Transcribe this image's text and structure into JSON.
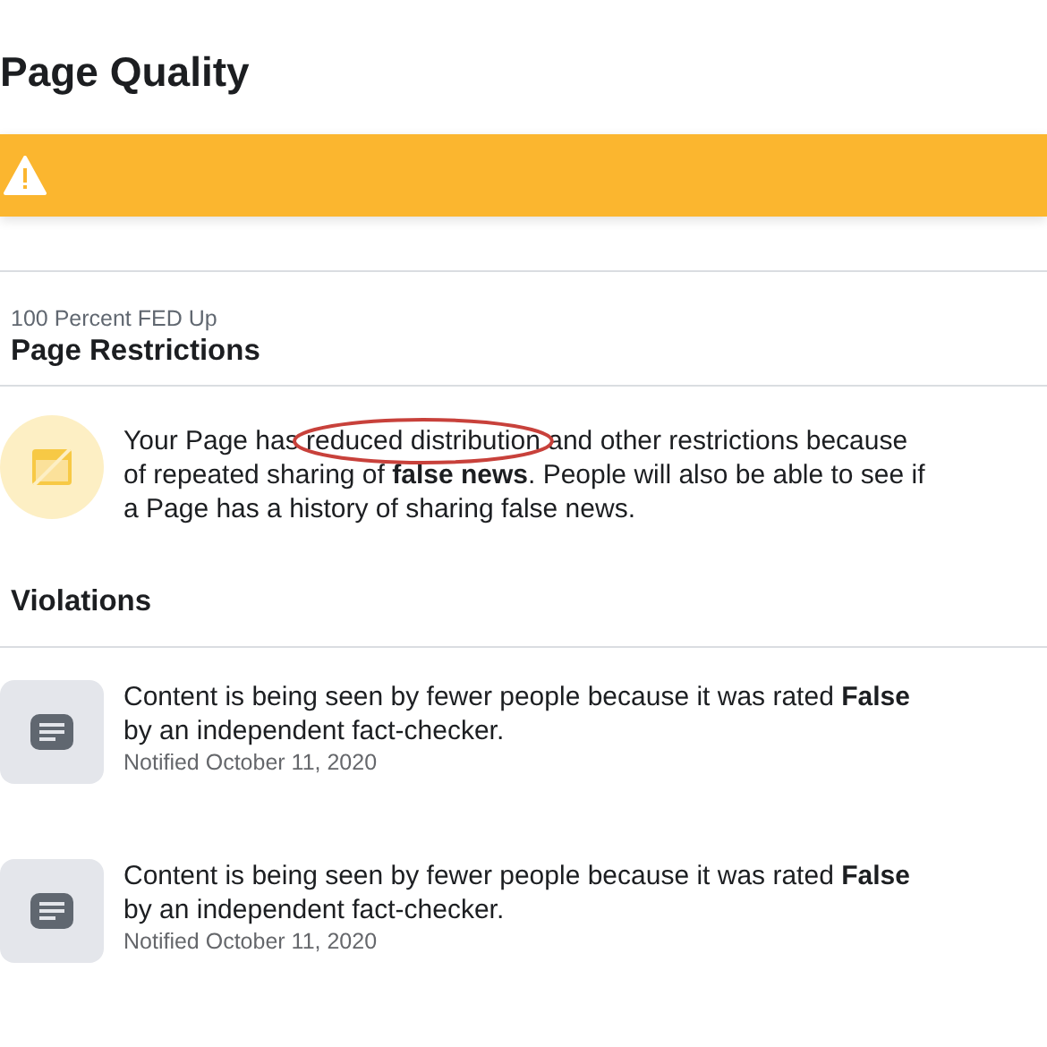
{
  "title": "Page Quality",
  "banner": {
    "kind": "warning"
  },
  "page": {
    "name": "100 Percent FED Up",
    "heading": "Page Restrictions"
  },
  "restriction": {
    "segments": [
      {
        "text": "Your Page has ",
        "circled": false
      },
      {
        "text": "reduced distribution",
        "circled": true
      },
      {
        "text": " and other restrictions because of repeated sharing of **false news**. People will also be able to see if a Page has a history of sharing false news.",
        "circled": false
      }
    ]
  },
  "violations": {
    "heading": "Violations",
    "items": [
      {
        "text": "Content is being seen by fewer people because it was rated **False** by an independent fact-checker.",
        "date": "Notified October 11, 2020"
      },
      {
        "text": "Content is being seen by fewer people because it was rated **False** by an independent fact-checker.",
        "date": "Notified October 11, 2020"
      }
    ]
  }
}
